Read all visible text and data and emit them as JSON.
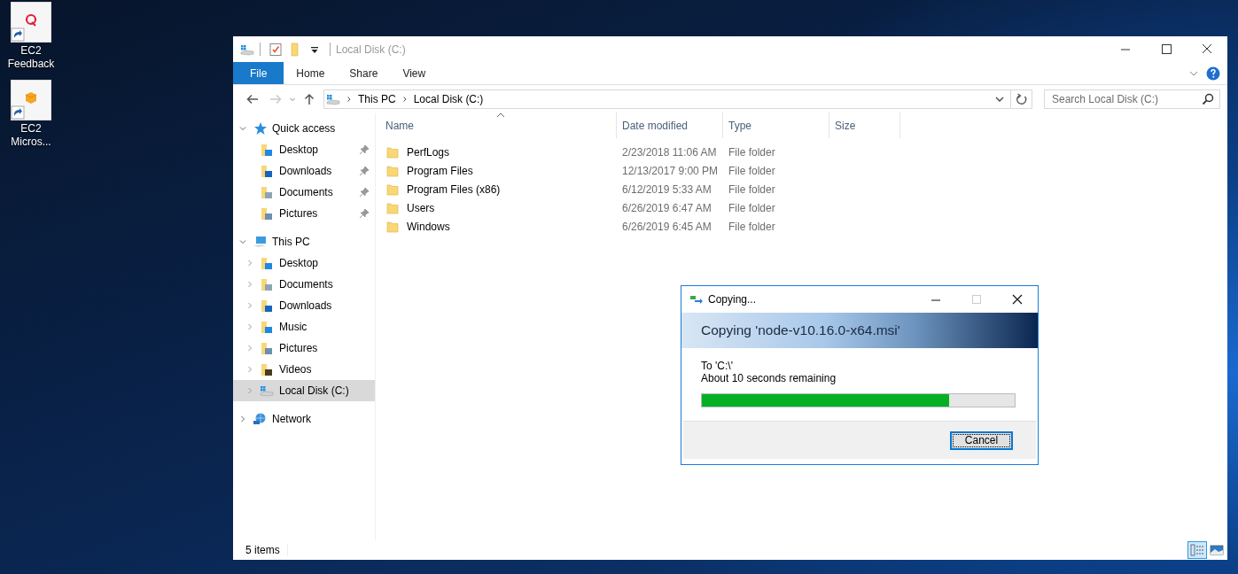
{
  "desktop_icons": [
    {
      "kind": "feedback",
      "lines": [
        "EC2",
        "Feedback"
      ]
    },
    {
      "kind": "box",
      "lines": [
        "EC2",
        "Micros..."
      ]
    }
  ],
  "explorer": {
    "title": "Local Disk (C:)",
    "ribbon_tabs": [
      {
        "label": "File",
        "selected": true
      },
      {
        "label": "Home",
        "selected": false
      },
      {
        "label": "Share",
        "selected": false
      },
      {
        "label": "View",
        "selected": false
      }
    ],
    "breadcrumb": [
      "This PC",
      "Local Disk (C:)"
    ],
    "search": {
      "placeholder": "Search Local Disk (C:)"
    },
    "nav": [
      {
        "label": "Quick access",
        "kind": "star",
        "expanded": true,
        "selected": false,
        "children": [
          {
            "label": "Desktop",
            "kind": "desktop",
            "pinned": true,
            "selected": false
          },
          {
            "label": "Downloads",
            "kind": "downloads",
            "pinned": true,
            "selected": false
          },
          {
            "label": "Documents",
            "kind": "documents",
            "pinned": true,
            "selected": false
          },
          {
            "label": "Pictures",
            "kind": "pictures",
            "pinned": true,
            "selected": false
          }
        ]
      },
      {
        "label": "This PC",
        "kind": "pc",
        "expanded": true,
        "selected": false,
        "children": [
          {
            "label": "Desktop",
            "kind": "desktop",
            "expanded": false,
            "selected": false
          },
          {
            "label": "Documents",
            "kind": "documents",
            "expanded": false,
            "selected": false
          },
          {
            "label": "Downloads",
            "kind": "downloads",
            "expanded": false,
            "selected": false
          },
          {
            "label": "Music",
            "kind": "music",
            "expanded": false,
            "selected": false
          },
          {
            "label": "Pictures",
            "kind": "pictures",
            "expanded": false,
            "selected": false
          },
          {
            "label": "Videos",
            "kind": "videos",
            "expanded": false,
            "selected": false
          },
          {
            "label": "Local Disk (C:)",
            "kind": "drive",
            "expanded": false,
            "selected": true
          }
        ]
      },
      {
        "label": "Network",
        "kind": "network",
        "expanded": false,
        "selected": false
      }
    ],
    "columns": [
      "Name",
      "Date modified",
      "Type",
      "Size"
    ],
    "rows": [
      {
        "name": "PerfLogs",
        "date": "2/23/2018 11:06 AM",
        "type": "File folder"
      },
      {
        "name": "Program Files",
        "date": "12/13/2017 9:00 PM",
        "type": "File folder"
      },
      {
        "name": "Program Files (x86)",
        "date": "6/12/2019 5:33 AM",
        "type": "File folder"
      },
      {
        "name": "Users",
        "date": "6/26/2019 6:47 AM",
        "type": "File folder"
      },
      {
        "name": "Windows",
        "date": "6/26/2019 6:45 AM",
        "type": "File folder"
      }
    ],
    "status": "5 items",
    "views": [
      {
        "kind": "details",
        "selected": true
      },
      {
        "kind": "thumbnails",
        "selected": false
      }
    ]
  },
  "dialog": {
    "title": "Copying...",
    "heading": "Copying 'node-v10.16.0-x64.msi'",
    "to": "To 'C:\\'",
    "remaining": "About 10 seconds remaining",
    "progress": {
      "level": 0.79
    },
    "button": "Cancel"
  }
}
